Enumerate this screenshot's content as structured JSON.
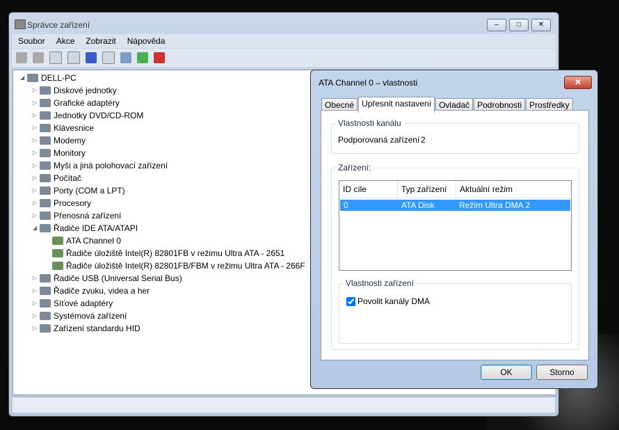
{
  "main": {
    "title": "Správce zařízení",
    "menu": [
      "Soubor",
      "Akce",
      "Zobrazit",
      "Nápověda"
    ],
    "tree": [
      {
        "label": "DELL-PC",
        "level": 0,
        "exp": "◢"
      },
      {
        "label": "Diskové jednotky",
        "level": 1,
        "exp": "▷"
      },
      {
        "label": "Grafické adaptéry",
        "level": 1,
        "exp": "▷"
      },
      {
        "label": "Jednotky DVD/CD-ROM",
        "level": 1,
        "exp": "▷"
      },
      {
        "label": "Klávesnice",
        "level": 1,
        "exp": "▷"
      },
      {
        "label": "Modemy",
        "level": 1,
        "exp": "▷"
      },
      {
        "label": "Monitory",
        "level": 1,
        "exp": "▷"
      },
      {
        "label": "Myši a jiná polohovací zařízení",
        "level": 1,
        "exp": "▷"
      },
      {
        "label": "Počítač",
        "level": 1,
        "exp": "▷"
      },
      {
        "label": "Porty (COM a LPT)",
        "level": 1,
        "exp": "▷"
      },
      {
        "label": "Procesory",
        "level": 1,
        "exp": "▷"
      },
      {
        "label": "Přenosná zařízení",
        "level": 1,
        "exp": "▷"
      },
      {
        "label": "Řadiče IDE ATA/ATAPI",
        "level": 1,
        "exp": "◢"
      },
      {
        "label": "ATA Channel 0",
        "level": 2,
        "exp": ""
      },
      {
        "label": "Řadiče úložiště Intel(R) 82801FB v režimu Ultra ATA - 2651",
        "level": 2,
        "exp": ""
      },
      {
        "label": "Řadiče úložiště Intel(R) 82801FB/FBM v režimu Ultra ATA - 266F",
        "level": 2,
        "exp": ""
      },
      {
        "label": "Řadiče USB (Universal Serial Bus)",
        "level": 1,
        "exp": "▷"
      },
      {
        "label": "Řadiče zvuku, videa a her",
        "level": 1,
        "exp": "▷"
      },
      {
        "label": "Síťové adaptéry",
        "level": 1,
        "exp": "▷"
      },
      {
        "label": "Systémová zařízení",
        "level": 1,
        "exp": "▷"
      },
      {
        "label": "Zařízení standardu HID",
        "level": 1,
        "exp": "▷"
      }
    ]
  },
  "dialog": {
    "title": "ATA Channel 0 – vlastnosti",
    "close": "✕",
    "tabs": [
      "Obecné",
      "Upřesnit nastavení",
      "Ovladač",
      "Podrobnosti",
      "Prostředky"
    ],
    "channel_group": "Vlastnosti kanálu",
    "supported_label": "Podporovaná zařízení",
    "supported_value": "2",
    "devices_group": "Zařízení:",
    "columns": [
      "ID cíle",
      "Typ zařízení",
      "Aktuální režim"
    ],
    "row": [
      "0",
      "ATA Disk",
      "Režim Ultra DMA 2"
    ],
    "dev_props_group": "Vlastnosti zařízení",
    "dma_label": "Povolit kanály DMA",
    "dma_checked": true,
    "ok": "OK",
    "cancel": "Storno"
  }
}
